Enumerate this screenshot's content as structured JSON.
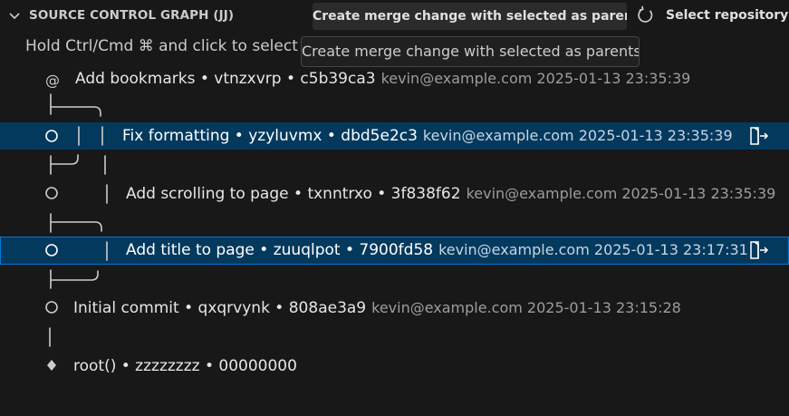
{
  "header": {
    "title": "SOURCE CONTROL GRAPH (JJ)",
    "merge_action_label": "Create merge change with selected as parents",
    "refresh_icon": "refresh-icon",
    "select_repository_label": "Select repository"
  },
  "hint": "Hold Ctrl/Cmd ⌘ and click to select",
  "tooltip": "Create merge change with selected as parents",
  "colors": {
    "background": "#181818",
    "selection": "#04395e",
    "focus_border": "#0078d4",
    "graph_lines": "#cccccc"
  },
  "commits": [
    {
      "marker": "@",
      "subject": "Add bookmarks • vtnzxvrp • c5b39ca3",
      "meta": "kevin@example.com 2025-01-13 23:35:39",
      "selected": false
    },
    {
      "marker": "circle",
      "subject": "Fix formatting • yzyluvmx • dbd5e2c3",
      "meta": "kevin@example.com 2025-01-13 23:35:39",
      "selected": true,
      "action_icon": "open-change-icon"
    },
    {
      "marker": "circle",
      "subject": "Add scrolling to page • txnntrxo • 3f838f62",
      "meta": "kevin@example.com 2025-01-13 23:35:39",
      "selected": false
    },
    {
      "marker": "circle",
      "subject": "Add title to page • zuuqlpot • 7900fd58",
      "meta": "kevin@example.com 2025-01-13 23:17:31",
      "selected": true,
      "focused": true,
      "action_icon": "open-change-icon"
    },
    {
      "marker": "circle",
      "subject": "Initial commit • qxqrvynk • 808ae3a9",
      "meta": "kevin@example.com 2025-01-13 23:15:28",
      "selected": false
    },
    {
      "marker": "diamond",
      "subject": "root() • zzzzzzzz • 00000000",
      "meta": "",
      "selected": false
    }
  ]
}
